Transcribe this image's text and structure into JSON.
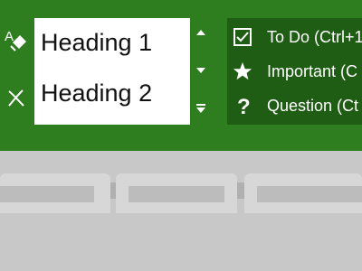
{
  "ribbon": {
    "background": "#2e7d1e",
    "tools": [
      {
        "icon": "format-painter-icon"
      },
      {
        "icon": "clear-formatting-icon"
      }
    ],
    "styles": [
      "Heading 1",
      "Heading 2"
    ],
    "scroll_icons": [
      "scroll-up-icon",
      "scroll-down-icon",
      "more-styles-icon"
    ],
    "tags": [
      {
        "label": "To Do (Ctrl+1",
        "icon": "checkbox-icon"
      },
      {
        "label": "Important (C",
        "icon": "star-icon"
      },
      {
        "label": "Question (Ct",
        "icon": "question-icon"
      }
    ]
  }
}
